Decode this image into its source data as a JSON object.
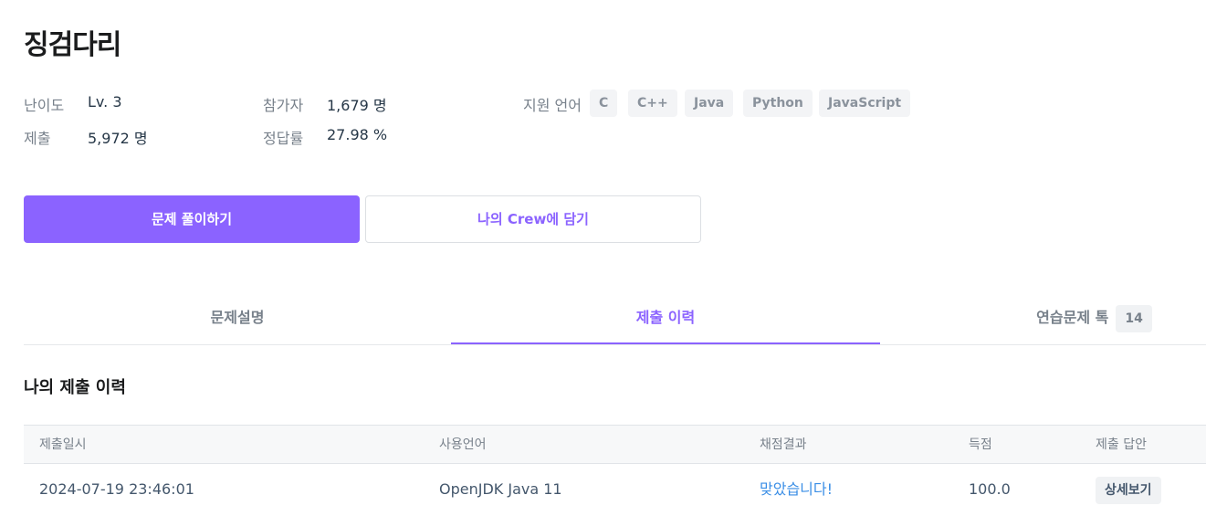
{
  "problem": {
    "title": "징검다리"
  },
  "meta": {
    "difficulty_label": "난이도",
    "difficulty_value": "Lv. 3",
    "submissions_label": "제출",
    "submissions_value": "5,972 명",
    "participants_label": "참가자",
    "participants_value": "1,679 명",
    "accuracy_label": "정답률",
    "accuracy_value": "27.98 %",
    "languages_label": "지원 언어",
    "languages": [
      "C",
      "C++",
      "Java",
      "Python",
      "JavaScript"
    ]
  },
  "actions": {
    "solve_label": "문제 풀이하기",
    "add_crew_label": "나의 Crew에 담기"
  },
  "tabs": {
    "items": [
      {
        "label": "문제설명"
      },
      {
        "label": "제출 이력"
      },
      {
        "label": "연습문제 톡",
        "badge": "14"
      }
    ],
    "active": "제출 이력"
  },
  "history": {
    "title": "나의 제출 이력",
    "columns": [
      "제출일시",
      "사용언어",
      "채점결과",
      "득점",
      "제출 답안"
    ],
    "rows": [
      {
        "submitted_at": "2024-07-19 23:46:01",
        "language": "OpenJDK Java 11",
        "result": "맞았습니다!",
        "score": "100.0",
        "action": "상세보기"
      }
    ]
  },
  "colors": {
    "accent": "#8b63ff",
    "result_pass": "#3a8ee6"
  }
}
